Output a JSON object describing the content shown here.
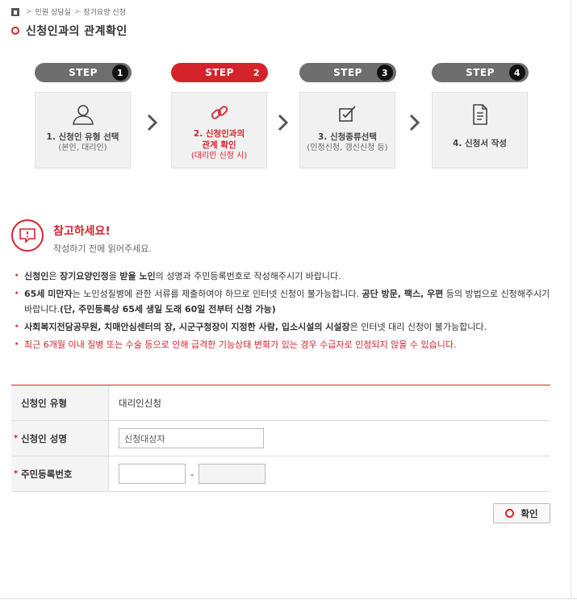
{
  "breadcrumb": {
    "items": [
      "민원 상담실",
      "장기요양 신청"
    ]
  },
  "page": {
    "title": "신청인과의 관계확인"
  },
  "steps": [
    {
      "pill": "STEP",
      "num": "1",
      "label": "1. 신청인 유형 선택",
      "sub": "(본인, 대리인)",
      "icon": "person-icon",
      "active": false
    },
    {
      "pill": "STEP",
      "num": "2",
      "label": "2. 신청인과의\n관계 확인",
      "sub": "(대리인 신청 시)",
      "icon": "link-icon",
      "active": true
    },
    {
      "pill": "STEP",
      "num": "3",
      "label": "3. 신청종류선택",
      "sub": "(인정신청, 갱신신청 등)",
      "icon": "checkbox-pen-icon",
      "active": false
    },
    {
      "pill": "STEP",
      "num": "4",
      "label": "4. 신청서 작성",
      "sub": "",
      "icon": "document-icon",
      "active": false
    }
  ],
  "notice": {
    "title": "참고하세요!",
    "sub": "작성하기 전에 읽어주세요."
  },
  "notes": [
    {
      "html_parts": [
        {
          "t": "신청인",
          "b": true
        },
        {
          "t": "은 ",
          "b": false
        },
        {
          "t": "장기요양인정",
          "b": true
        },
        {
          "t": "을 ",
          "b": false
        },
        {
          "t": "받을 노인",
          "b": true
        },
        {
          "t": "의 성명과 주민등록번호로 작성해주시기 바랍니다.",
          "b": false
        }
      ],
      "red": false
    },
    {
      "html_parts": [
        {
          "t": "65세 미만자",
          "b": true
        },
        {
          "t": "는 노인성질병에 관한 서류를 제출하여야 하므로 인터넷 신청이 불가능합니다. ",
          "b": false
        },
        {
          "t": "공단 방문, 팩스, 우편",
          "b": true
        },
        {
          "t": " 등의 방법으로 신청해주시기 바랍니다.",
          "b": false
        },
        {
          "t": "(단, 주민등록상 65세 생일 도래 60일 전부터 신청 가능)",
          "b": true
        }
      ],
      "red": false
    },
    {
      "html_parts": [
        {
          "t": "사회복지전담공무원, 치매안심센터의 장, 시군구청장이 지정한 사람, 입소시설의 시설장",
          "b": true
        },
        {
          "t": "은 인터넷 대리 신청이 불가능합니다.",
          "b": false
        }
      ],
      "red": false
    },
    {
      "html_parts": [
        {
          "t": "최근 6개월 이내 질병 또는 수술 등으로 인해 급격한 기능상태 변화가 있는 경우 수급자로 인정되지 않을 수 있습니다.",
          "b": false
        }
      ],
      "red": true
    }
  ],
  "form": {
    "type_label": "신청인 유형",
    "type_value": "대리인신청",
    "name_label": "신청인 성명",
    "name_value": "신청대상자",
    "rrn_label": "주민등록번호",
    "rrn_dash": "-",
    "required_mark": "*"
  },
  "buttons": {
    "confirm": "확인"
  },
  "colors": {
    "accent": "#d4232b",
    "step_inactive": "#6e6e6e"
  }
}
